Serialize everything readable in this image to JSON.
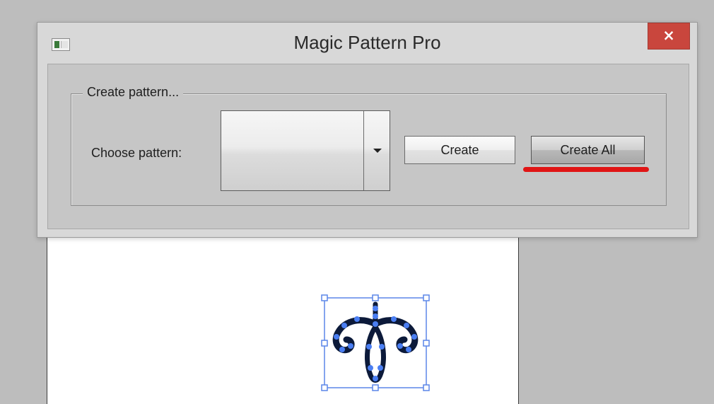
{
  "window": {
    "title": "Magic Pattern Pro",
    "close_symbol": "×"
  },
  "group": {
    "legend": "Create pattern...",
    "choose_label": "Choose pattern:",
    "pattern_select_value": "",
    "create_label": "Create",
    "create_all_label": "Create All"
  },
  "icons": {
    "app": "app-window-icon",
    "close": "close-icon",
    "dropdown": "chevron-down-icon"
  },
  "colors": {
    "close_button": "#c9463d",
    "annotation_underline": "#e01515",
    "selection_handles": "#4a7ef2"
  }
}
